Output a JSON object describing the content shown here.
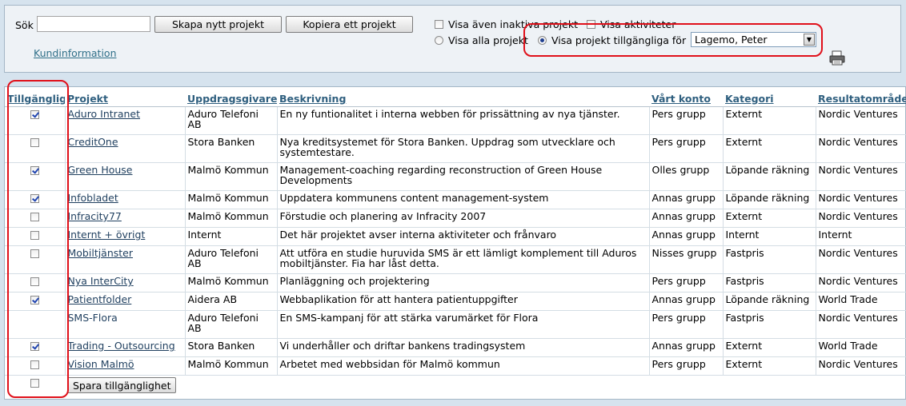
{
  "toolbar": {
    "search_label": "Sök",
    "search_value": "",
    "new_project_label": "Skapa nytt projekt",
    "copy_project_label": "Kopiera ett projekt",
    "customer_info_link": "Kundinformation"
  },
  "filters": {
    "show_inactive_label": "Visa även inaktiva projekt",
    "show_inactive_checked": false,
    "show_activities_label": "Visa aktiviteter",
    "show_activities_checked": false,
    "show_all_label": "Visa alla projekt",
    "show_available_label": "Visa projekt tillgängliga för",
    "selected_mode": "available",
    "user_select_value": "Lagemo, Peter"
  },
  "table": {
    "headers": [
      "Tillgängligt",
      "Projekt",
      "Uppdragsgivare",
      "Beskrivning",
      "Vårt konto",
      "Kategori",
      "Resultatområde"
    ],
    "rows": [
      {
        "available": true,
        "project": "Aduro Intranet",
        "linked": true,
        "client": "Aduro Telefoni AB",
        "description": "En ny funtionalitet i interna webben för prissättning av nya tjänster.",
        "account": "Pers grupp",
        "category": "Externt",
        "area": "Nordic Ventures"
      },
      {
        "available": false,
        "project": "CreditOne",
        "linked": true,
        "client": "Stora Banken",
        "description": "Nya kreditsystemet för Stora Banken. Uppdrag som utvecklare och systemtestare.",
        "account": "Pers grupp",
        "category": "Externt",
        "area": "Nordic Ventures"
      },
      {
        "available": true,
        "project": "Green House",
        "linked": true,
        "client": "Malmö Kommun",
        "description": "Management-coaching regarding reconstruction of Green House Developments",
        "account": "Olles grupp",
        "category": "Löpande räkning",
        "area": "Nordic Ventures"
      },
      {
        "available": true,
        "project": "Infobladet",
        "linked": true,
        "client": "Malmö Kommun",
        "description": "Uppdatera kommunens content management-system",
        "account": "Annas grupp",
        "category": "Löpande räkning",
        "area": "Nordic Ventures"
      },
      {
        "available": false,
        "project": "Infracity77",
        "linked": true,
        "client": "Malmö Kommun",
        "description": "Förstudie och planering av Infracity 2007",
        "account": "Annas grupp",
        "category": "Externt",
        "area": "Nordic Ventures"
      },
      {
        "available": false,
        "project": "Internt + övrigt",
        "linked": true,
        "client": "Internt",
        "description": "Det här projektet avser interna aktiviteter och frånvaro",
        "account": "Annas grupp",
        "category": "Internt",
        "area": "Internt"
      },
      {
        "available": false,
        "project": "Mobiltjänster",
        "linked": true,
        "client": "Aduro Telefoni AB",
        "description": "Att utföra en studie huruvida SMS är ett lämligt komplement till Aduros mobiltjänster. Fia har låst detta.",
        "account": "Nisses grupp",
        "category": "Fastpris",
        "area": "Nordic Ventures"
      },
      {
        "available": false,
        "project": "Nya InterCity",
        "linked": true,
        "client": "Malmö Kommun",
        "description": "Planläggning och projektering",
        "account": "Pers grupp",
        "category": "Fastpris",
        "area": "Nordic Ventures"
      },
      {
        "available": true,
        "project": "Patientfolder",
        "linked": true,
        "client": "Aidera AB",
        "description": "Webbaplikation för att hantera patientuppgifter",
        "account": "Annas grupp",
        "category": "Löpande räkning",
        "area": "World Trade"
      },
      {
        "available": null,
        "project": "SMS-Flora",
        "linked": false,
        "client": "Aduro Telefoni AB",
        "description": "En SMS-kampanj för att stärka varumärket för Flora",
        "account": "Pers grupp",
        "category": "Fastpris",
        "area": "Nordic Ventures"
      },
      {
        "available": true,
        "project": "Trading - Outsourcing",
        "linked": true,
        "client": "Stora Banken",
        "description": "Vi underhåller och driftar bankens tradingsystem",
        "account": "Annas grupp",
        "category": "Externt",
        "area": "World Trade"
      },
      {
        "available": false,
        "project": "Vision Malmö",
        "linked": true,
        "client": "Malmö Kommun",
        "description": "Arbetet med webbsidan för Malmö kommun",
        "account": "Pers grupp",
        "category": "Externt",
        "area": "Nordic Ventures"
      }
    ],
    "footer_checkbox_checked": false,
    "save_label": "Spara tillgänglighet"
  },
  "colors": {
    "background": "#d6e3ee",
    "link": "#2f6f88",
    "header_text": "#2f5f7f",
    "highlight": "#e0101a"
  },
  "icons": {
    "print": "printer-icon"
  }
}
